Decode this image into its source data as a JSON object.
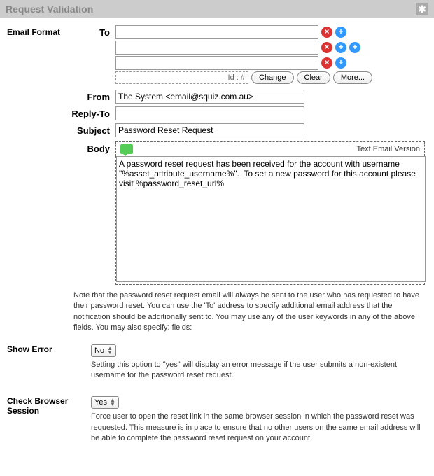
{
  "header": {
    "title": "Request Validation"
  },
  "emailFormat": {
    "sectionLabel": "Email Format",
    "labels": {
      "to": "To",
      "from": "From",
      "replyTo": "Reply-To",
      "subject": "Subject",
      "body": "Body"
    },
    "to": {
      "rows": [
        "",
        "",
        ""
      ],
      "idLabel": "Id : #"
    },
    "buttons": {
      "change": "Change",
      "clear": "Clear",
      "more": "More..."
    },
    "from": "The System <email@squiz.com.au>",
    "replyTo": "",
    "subject": "Password Reset Request",
    "bodyVersionLabel": "Text Email Version",
    "body": "A password reset request has been received for the account with username \"%asset_attribute_username%\".  To set a new password for this account please visit %password_reset_url%",
    "note": "Note that the password reset request email will always be sent to the user who has requested to have their password reset. You can use the 'To' address to specify additional email address that the notification should be additionally sent to. You may use any of the user keywords in any of the above fields. You may also specify: fields:"
  },
  "showError": {
    "label": "Show Error",
    "value": "No",
    "help": "Setting this option to \"yes\" will display an error message if the user submits a non-existent username for the password reset request."
  },
  "checkBrowser": {
    "label": "Check Browser Session",
    "value": "Yes",
    "help": "Force user to open the reset link in the same browser session in which the password reset was requested. This measure is in place to ensure that no other users on the same email address will be able to complete the password reset request on your account."
  }
}
